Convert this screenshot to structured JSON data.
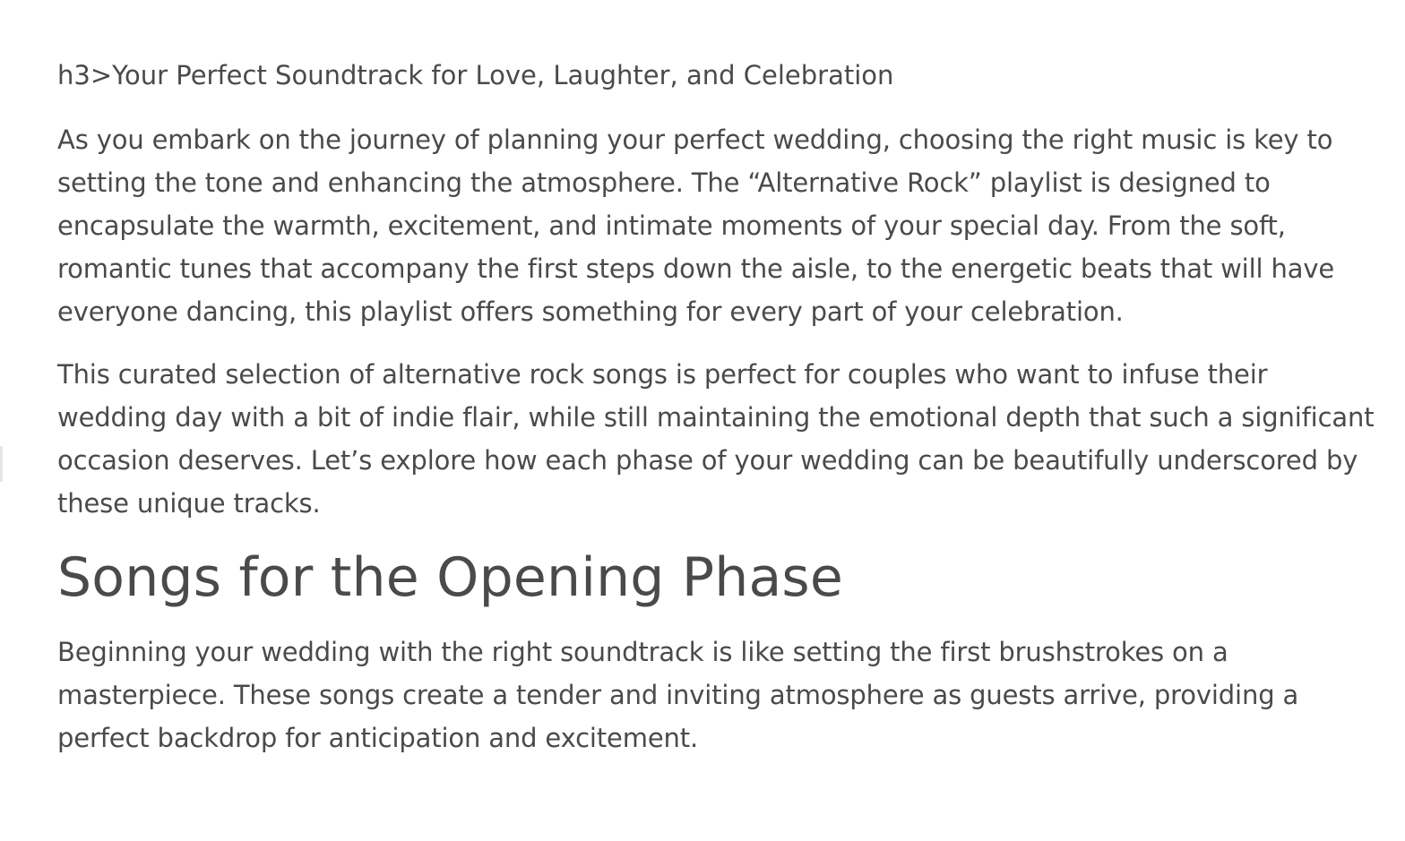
{
  "article": {
    "raw_heading": "h3>Your Perfect Soundtrack for Love, Laughter, and Celebration",
    "intro_paragraph_1": "As you embark on the journey of planning your perfect wedding, choosing the right music is key to setting the tone and enhancing the atmosphere. The “Alternative Rock” playlist is designed to encapsulate the warmth, excitement, and intimate moments of your special day. From the soft, romantic tunes that accompany the first steps down the aisle, to the energetic beats that will have everyone dancing, this playlist offers something for every part of your celebration.",
    "intro_paragraph_2": "This curated selection of alternative rock songs is perfect for couples who want to infuse their wedding day with a bit of indie flair, while still maintaining the emotional depth that such a significant occasion deserves. Let’s explore how each phase of your wedding can be beautifully underscored by these unique tracks.",
    "section_heading": "Songs for the Opening Phase",
    "section_paragraph": "Beginning your wedding with the right soundtrack is like setting the first brushstrokes on a masterpiece. These songs create a tender and inviting atmosphere as guests arrive, providing a perfect backdrop for anticipation and excitement."
  },
  "colors": {
    "text": "#4a4a4a",
    "background": "#ffffff"
  }
}
